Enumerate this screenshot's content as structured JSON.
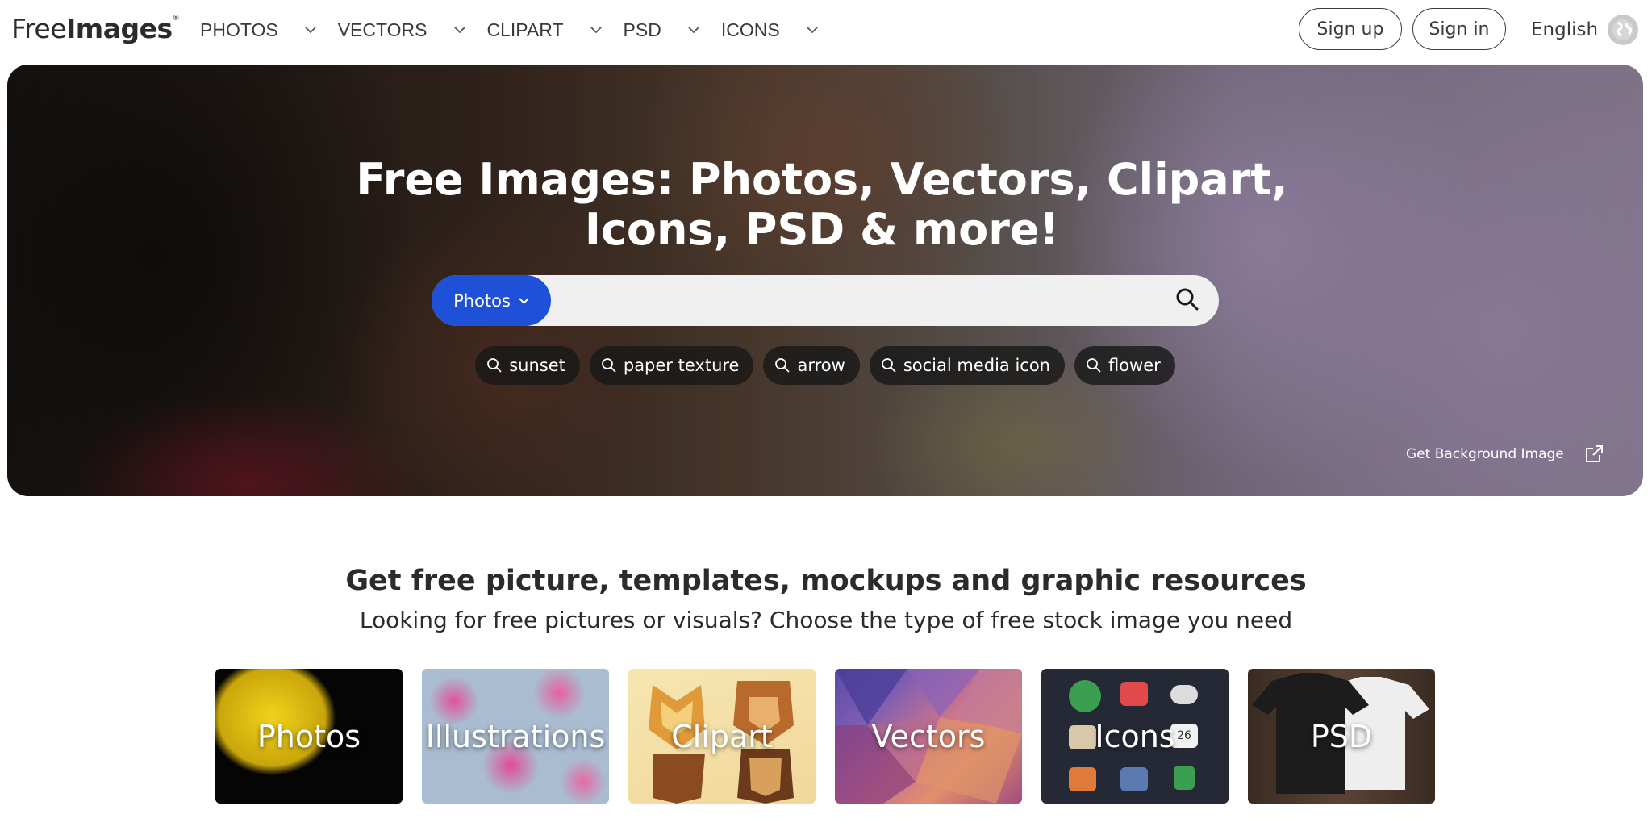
{
  "header": {
    "logo_light": "Free",
    "logo_bold": "Images",
    "logo_mark": "®",
    "nav": [
      {
        "label": "PHOTOS"
      },
      {
        "label": "VECTORS"
      },
      {
        "label": "CLIPART"
      },
      {
        "label": "PSD"
      },
      {
        "label": "ICONS"
      }
    ],
    "signup_label": "Sign up",
    "signin_label": "Sign in",
    "language": "English"
  },
  "hero": {
    "title": "Free Images: Photos, Vectors, Clipart, Icons, PSD & more!",
    "search_type": "Photos",
    "search_placeholder": "",
    "tags": [
      {
        "label": "sunset"
      },
      {
        "label": "paper texture"
      },
      {
        "label": "arrow"
      },
      {
        "label": "social media icon"
      },
      {
        "label": "flower"
      }
    ],
    "get_background_label": "Get Background Image"
  },
  "section": {
    "title": "Get free picture, templates, mockups and graphic resources",
    "subtitle": "Looking for free pictures or visuals? Choose the type of free stock image you need"
  },
  "categories": [
    {
      "label": "Photos"
    },
    {
      "label": "Illustrations"
    },
    {
      "label": "Clipart"
    },
    {
      "label": "Vectors"
    },
    {
      "label": "Icons"
    },
    {
      "label": "PSD"
    }
  ],
  "icons_tile": {
    "calendar_day": "26"
  },
  "colors": {
    "accent": "#1e50d8",
    "hero_tag_bg": "#181818",
    "text": "#2b2b2b"
  }
}
